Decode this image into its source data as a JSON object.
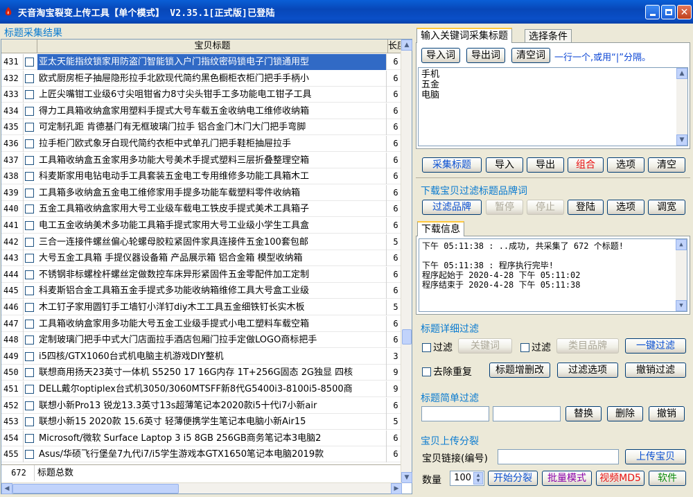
{
  "window": {
    "title": "天音淘宝裂变上传工具【单个模式】 V2.35.1[正式版]已登陆"
  },
  "left": {
    "section_title": "标题采集结果",
    "columns": {
      "title": "宝贝标题",
      "length": "长度"
    },
    "rows": [
      {
        "num": "431",
        "title": "亚太天能指纹锁家用防盗门智能锁入户门指纹密码锁电子门锁通用型",
        "len": "6",
        "selected": true
      },
      {
        "num": "432",
        "title": "欧式厨房柜子抽屉隐形拉手北欧现代简约黑色橱柜衣柜门把手手柄小",
        "len": "6"
      },
      {
        "num": "433",
        "title": "上匠尖嘴钳工业级6寸尖咀钳省力8寸尖头钳手工多功能电工钳子工具",
        "len": "6"
      },
      {
        "num": "434",
        "title": "得力工具箱收纳盒家用塑料手提式大号车载五金收纳电工维修收纳箱",
        "len": "6"
      },
      {
        "num": "435",
        "title": "可定制孔距 肯德基门有无框玻璃门拉手 铝合金门木门大门把手弯脚",
        "len": "6"
      },
      {
        "num": "436",
        "title": "拉手柜门欧式象牙白现代简约衣柜中式单孔门把手鞋柜抽屉拉手",
        "len": "6"
      },
      {
        "num": "437",
        "title": "工具箱收纳盒五金家用多功能大号美术手提式塑料三层折叠整理空箱",
        "len": "6"
      },
      {
        "num": "438",
        "title": "科麦斯家用电钻电动手工具套装五金电工专用维修多功能工具箱木工",
        "len": "6"
      },
      {
        "num": "439",
        "title": "工具箱多收纳盒五金电工维修家用手提多功能车载塑料零件收纳箱",
        "len": "6"
      },
      {
        "num": "440",
        "title": "五金工具箱收纳盒家用大号工业级车载电工铁皮手提式美术工具箱子",
        "len": "6"
      },
      {
        "num": "441",
        "title": "电工五金收纳美术多功能工具箱手提式家用大号工业级小学生工具盒",
        "len": "6"
      },
      {
        "num": "442",
        "title": "三合一连接件螺丝偏心轮螺母胶粒紧固件家具连接件五金100套包邮",
        "len": "5"
      },
      {
        "num": "443",
        "title": "大号五金工具箱 手提仪器设备箱 产品展示箱 铝合金箱 模型收纳箱",
        "len": "6"
      },
      {
        "num": "444",
        "title": "不锈钢非标螺栓杆螺丝定做数控车床异形紧固件五金零配件加工定制",
        "len": "6"
      },
      {
        "num": "445",
        "title": "科麦斯铝合金工具箱五金手提式多功能收纳箱维修工具大号盒工业级",
        "len": "6"
      },
      {
        "num": "446",
        "title": "木工钉子家用圆钉手工墙钉小洋钉diy木工工具五金细铁钉长实木板",
        "len": "5"
      },
      {
        "num": "447",
        "title": "工具箱收纳盒家用多功能大号五金工业级手提式小电工塑料车载空箱",
        "len": "6"
      },
      {
        "num": "448",
        "title": "定制玻璃门把手中式大门店面拉手酒店包厢门拉手定做LOGO商标把手",
        "len": "6"
      },
      {
        "num": "449",
        "title": "i5四核/GTX1060台式机电脑主机游戏DIY整机",
        "len": "3"
      },
      {
        "num": "450",
        "title": "联想商用扬天23英寸一体机 S5250 17 16G内存 1T+256G固态 2G独显 四核",
        "len": "9"
      },
      {
        "num": "451",
        "title": "DELL戴尔optiplex台式机3050/3060MTSFF新8代G5400i3-8100i5-8500商",
        "len": "9"
      },
      {
        "num": "452",
        "title": "联想小新Pro13 锐龙13.3英寸13s超薄笔记本2020款i5十代i7小新air",
        "len": "6"
      },
      {
        "num": "453",
        "title": "联想小新15 2020款 15.6英寸 轻薄便携学生笔记本电脑小新Air15",
        "len": "5"
      },
      {
        "num": "454",
        "title": "Microsoft/微软 Surface Laptop 3 i5 8GB 256GB商务笔记本3电脑2",
        "len": "6"
      },
      {
        "num": "455",
        "title": "Asus/华硕飞行堡垒7九代i7/i5学生游戏本GTX1650笔记本电脑2019款",
        "len": "6"
      }
    ],
    "footer": {
      "count": "672",
      "label": "标题总数"
    }
  },
  "right": {
    "tabs": [
      "输入关键词采集标题",
      "选择条件"
    ],
    "import_btn": "导入词",
    "export_btn": "导出词",
    "clear_btn": "清空词",
    "hint": "一行一个,或用“|”分隔。",
    "keywords": [
      "手机",
      "五金",
      "电脑"
    ],
    "row_buttons": [
      "采集标题",
      "导入",
      "导出",
      "组合",
      "选项",
      "清空"
    ],
    "brand_filter_label": "下载宝贝过滤标题品牌词",
    "brand_buttons": [
      "过滤品牌",
      "暂停",
      "停止",
      "登陆",
      "选项",
      "调宽"
    ],
    "log_tab": "下载信息",
    "log_lines": [
      "下午 05:11:38 : ..成功, 共采集了 672 个标题!",
      "",
      "下午 05:11:38 : 程序执行完毕!",
      "程序起始于 2020-4-28 下午 05:11:02",
      "程序结束于 2020-4-28 下午 05:11:38"
    ],
    "detail_filter_label": "标题详细过滤",
    "filter1_label": "过滤",
    "keyword_btn": "关键词",
    "filter2_label": "过滤",
    "category_btn": "类目品牌",
    "one_click_btn": "一键过滤",
    "dedupe_label": "去除重复",
    "edit_btn": "标题增删改",
    "filter_options_btn": "过滤选项",
    "undo_filter_btn": "撤销过滤",
    "simple_filter_label": "标题简单过滤",
    "replace_btn": "替换",
    "delete_btn": "删除",
    "undo_btn": "撤销",
    "upload_section_label": "宝贝上传分裂",
    "link_label": "宝贝链接(编号)",
    "upload_btn": "上传宝贝",
    "qty_label": "数量",
    "qty_value": "100",
    "split_btn": "开始分裂",
    "batch_btn": "批量模式",
    "video_btn": "视频MD5",
    "software_btn": "软件"
  }
}
